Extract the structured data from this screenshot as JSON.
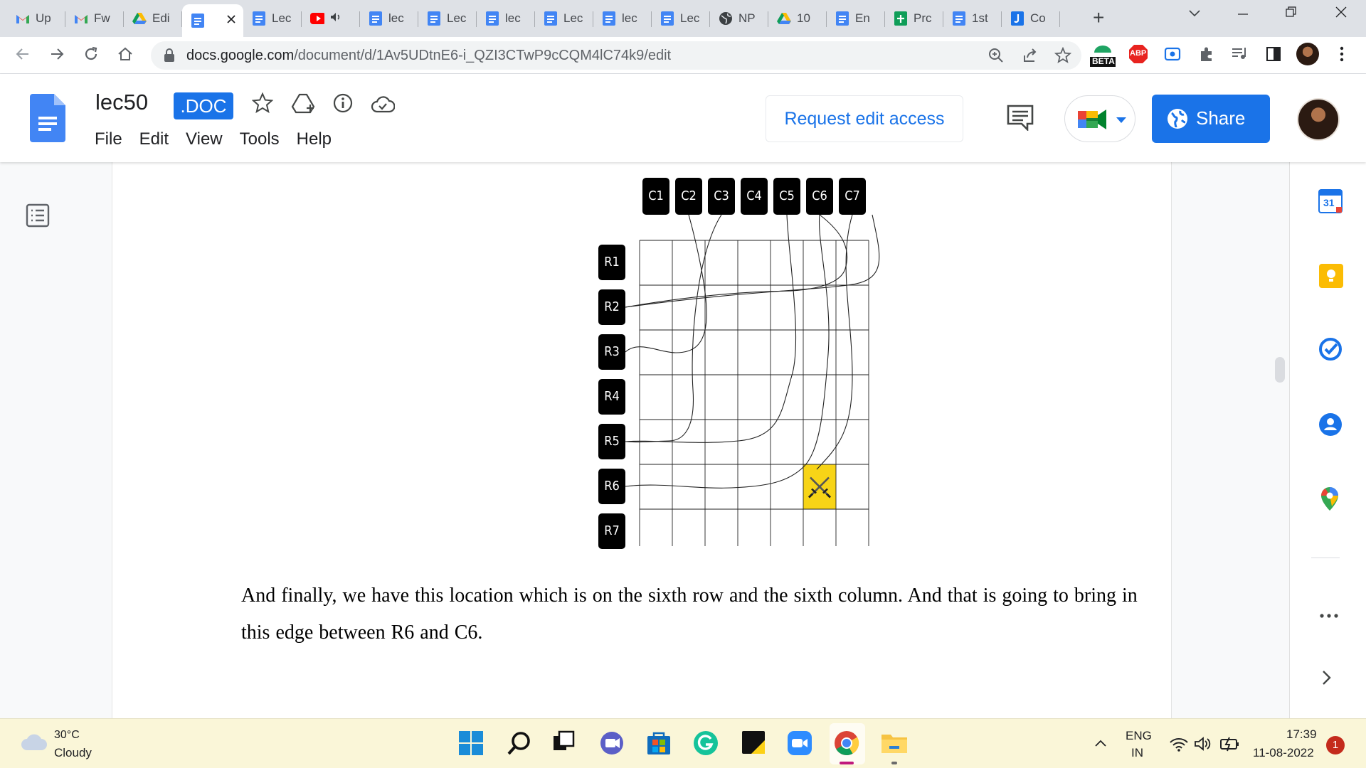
{
  "browser": {
    "tabs": [
      {
        "label": "Up",
        "icon": "gmail-icon"
      },
      {
        "label": "Fw",
        "icon": "gmail-icon"
      },
      {
        "label": "Edi",
        "icon": "drive-icon"
      },
      {
        "label": "",
        "icon": "docs-icon",
        "active": true
      },
      {
        "label": "Lec",
        "icon": "docs-icon"
      },
      {
        "label": "",
        "icon": "youtube-icon"
      },
      {
        "label": "lec",
        "icon": "docs-icon"
      },
      {
        "label": "Lec",
        "icon": "docs-icon"
      },
      {
        "label": "lec",
        "icon": "docs-icon"
      },
      {
        "label": "Lec",
        "icon": "docs-icon"
      },
      {
        "label": "lec",
        "icon": "docs-icon"
      },
      {
        "label": "Lec",
        "icon": "docs-icon"
      },
      {
        "label": "NP",
        "icon": "globe-icon"
      },
      {
        "label": "10",
        "icon": "drive-icon"
      },
      {
        "label": "En",
        "icon": "docs-icon"
      },
      {
        "label": "Prc",
        "icon": "sheets-icon"
      },
      {
        "label": "1st",
        "icon": "docs-icon"
      },
      {
        "label": "Co",
        "icon": "jamboard-icon"
      }
    ],
    "url_host": "docs.google.com",
    "url_path": "/document/d/1Av5UDtnE6-i_QZI3CTwP9cCQM4lC74k9/edit",
    "extension_beta": "BETA",
    "extension_abp": "ABP"
  },
  "docs": {
    "title": "lec50",
    "badge": ".DOC",
    "menu": [
      "File",
      "Edit",
      "View",
      "Tools",
      "Help"
    ],
    "request_edit": "Request edit access",
    "share": "Share"
  },
  "figure": {
    "columns": [
      "C1",
      "C2",
      "C3",
      "C4",
      "C5",
      "C6",
      "C7"
    ],
    "rows": [
      "R1",
      "R2",
      "R3",
      "R4",
      "R5",
      "R6",
      "R7"
    ],
    "highlight_cell": {
      "row": 6,
      "column": 6,
      "color": "#f7d417",
      "icon": "crossed-swords-icon"
    }
  },
  "paragraph": "And finally, we have this location which is on the sixth row and the sixth column. And that is going to bring in this edge between R6 and C6.",
  "sidepanel": {
    "calendar_day": "31"
  },
  "taskbar": {
    "temperature": "30°C",
    "condition": "Cloudy",
    "lang_line1": "ENG",
    "lang_line2": "IN",
    "time": "17:39",
    "date": "11-08-2022",
    "notifications": "1"
  }
}
